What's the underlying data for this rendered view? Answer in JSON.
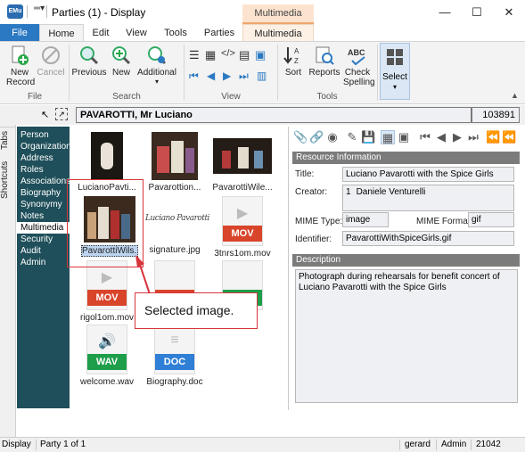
{
  "window": {
    "title": "Parties (1) - Display",
    "app_icon_text": "EMu",
    "context_tab_group": "Multimedia Tools",
    "minimize": "—",
    "maximize": "☐",
    "close": "✕"
  },
  "ribbon": {
    "tabs": [
      "File",
      "Home",
      "Edit",
      "View",
      "Tools",
      "Parties",
      "Multimedia"
    ],
    "file_group": {
      "label": "File",
      "new_record": "New Record",
      "cancel": "Cancel"
    },
    "search_group": {
      "label": "Search",
      "previous": "Previous",
      "new": "New",
      "additional": "Additional"
    },
    "view_group": {
      "label": "View"
    },
    "tools_group": {
      "label": "Tools",
      "sort": "Sort",
      "reports": "Reports",
      "check_spelling": "Check Spelling"
    },
    "select": "Select"
  },
  "record": {
    "name": "PAVAROTTI, Mr Luciano",
    "irn": "103891"
  },
  "side_tabs": {
    "tabs": "Tabs",
    "shortcuts": "Shortcuts"
  },
  "nav": {
    "items": [
      "Person",
      "Organization",
      "Address",
      "Roles",
      "Associations",
      "Biography",
      "Synonymy",
      "Notes",
      "Multimedia",
      "Security",
      "Audit",
      "Admin"
    ],
    "selected": "Multimedia"
  },
  "thumbnails": [
    {
      "label": "LucianoPavti...",
      "kind": "photo"
    },
    {
      "label": "Pavarottion...",
      "kind": "photo"
    },
    {
      "label": "PavarottiWile...",
      "kind": "photo"
    },
    {
      "label": "PavarottiWils...",
      "kind": "photo",
      "selected": true
    },
    {
      "label": "signature.jpg",
      "kind": "signature",
      "signature_text": "Luciano Pavarotti"
    },
    {
      "label": "3tnrs1om.mov",
      "kind": "file",
      "format": "MOV",
      "color": "#d9452b"
    },
    {
      "label": "rigol1om.mov",
      "kind": "file",
      "format": "MOV",
      "color": "#d9452b"
    },
    {
      "label": "welcome.wav",
      "kind": "file",
      "format": "WAV",
      "color": "#1e9e4a"
    },
    {
      "label": "Biography.doc",
      "kind": "file",
      "format": "DOC",
      "color": "#2f7fd6"
    }
  ],
  "callout": {
    "text": "Selected image."
  },
  "resource": {
    "section_title": "Resource Information",
    "title_label": "Title:",
    "title_value": "Luciano Pavarotti with the Spice Girls",
    "creator_label": "Creator:",
    "creator_index": "1",
    "creator_value": "Daniele Venturelli",
    "mime_type_label": "MIME Type:",
    "mime_type_value": "image",
    "mime_format_label": "MIME Format:",
    "mime_format_value": "gif",
    "identifier_label": "Identifier:",
    "identifier_value": "PavarottiWithSpiceGirls.gif"
  },
  "description": {
    "section_title": "Description",
    "text": "Photograph during rehearsals for benefit concert of Luciano Pavarotti with the Spice Girls"
  },
  "status": {
    "mode": "Display",
    "position": "Party 1 of 1",
    "user": "gerard",
    "role": "Admin",
    "port": "21042"
  },
  "colors": {
    "accent": "#2b79c2",
    "nav_bg": "#1f4f5a",
    "context_tab": "#fbe3cf",
    "highlight": "#d8343b"
  }
}
